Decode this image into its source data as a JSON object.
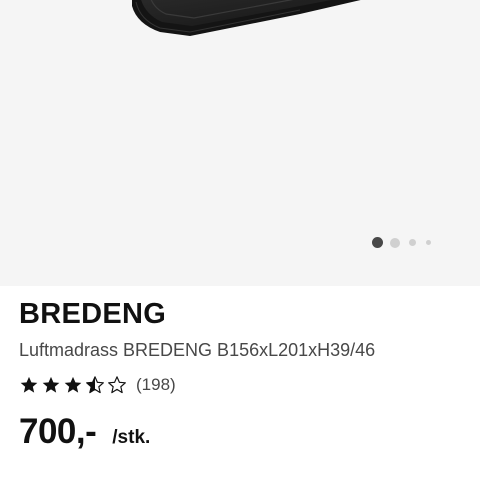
{
  "product": {
    "image_alt": "air mattress product image",
    "gallery": {
      "total": 4,
      "active": 1
    },
    "name": "BREDENG",
    "description": "Luftmadrass BREDENG B156xL201xH39/46",
    "rating": {
      "stars": 3.5,
      "max": 5,
      "count_label": "(198)"
    },
    "price": "700,-",
    "unit": "/stk."
  },
  "colors": {
    "hero_background": "#f5f5f5",
    "product_dark": "#1e1e1e",
    "star": "#111111",
    "text_primary": "#111111",
    "text_secondary": "#484848",
    "dot_active": "#484848",
    "dot_inactive": "#d0d0d0"
  }
}
